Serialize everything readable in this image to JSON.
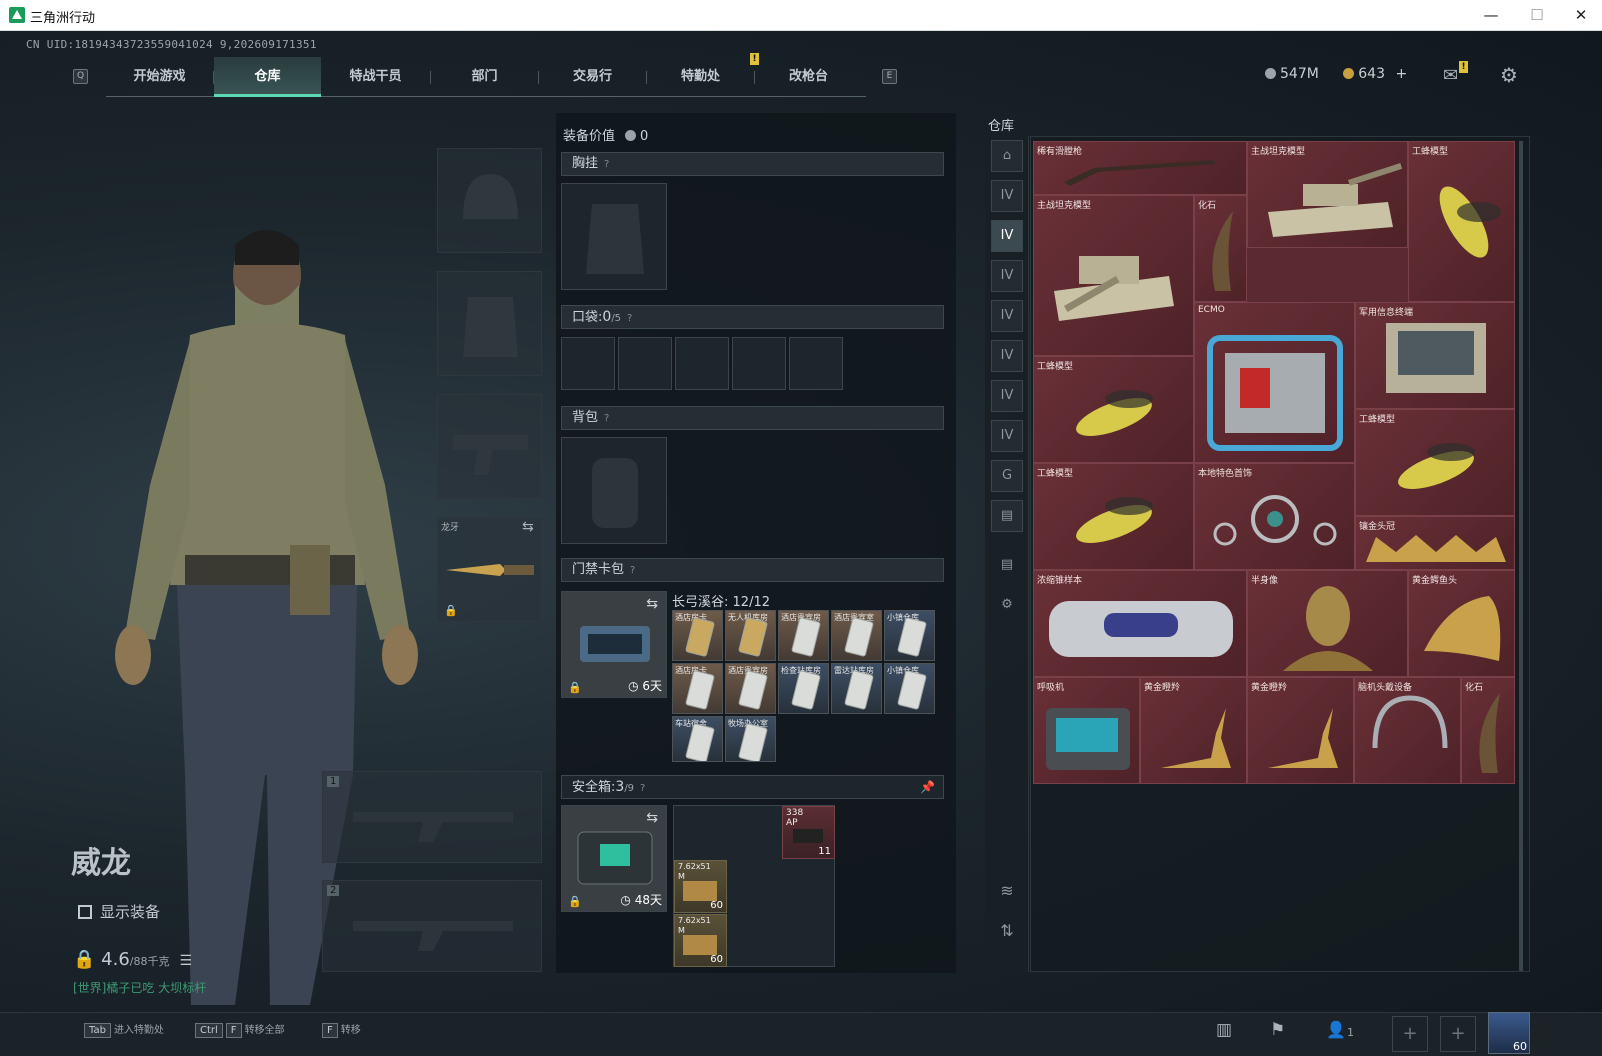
{
  "window": {
    "title": "三角洲行动",
    "minimize": "—",
    "maximize": "☐",
    "close": "✕"
  },
  "uid": "CN UID:18194343723559041024 9,202609171351",
  "nav": {
    "key_left": "Q",
    "key_right": "E",
    "tabs": [
      "开始游戏",
      "仓库",
      "特战干员",
      "部门",
      "交易行",
      "特勤处",
      "改枪台"
    ],
    "active": "仓库",
    "notice": "!"
  },
  "currency": {
    "silver": "547M",
    "gold": "643",
    "plus": "+",
    "mail_badge": "!"
  },
  "character": {
    "name": "威龙",
    "show_equipment": "显示装备",
    "weight": "4.6",
    "weight_max": "/88千克",
    "world_tag": "[世界]",
    "world_title": "橘子已吃 大坝标杆"
  },
  "gear_slots": {
    "melee_label": "龙牙",
    "primary_num": "1",
    "secondary_num": "2"
  },
  "equipment": {
    "value_label": "装备价值",
    "value": "0",
    "chest_rig": "胸挂",
    "pockets_label": "口袋:",
    "pockets_value": "0",
    "pockets_max": "/5",
    "backpack": "背包",
    "keycard_bag": "门禁卡包",
    "keycard_timer": "6天",
    "keycard_map": "长弓溪谷:",
    "keycard_count": "12/12",
    "keycards": [
      "酒店房卡",
      "无人机库房",
      "酒店贵宾房",
      "酒店贵宾室",
      "小镇仓库",
      "酒店房卡",
      "酒店贵宾房",
      "检查站库房",
      "雷达站库房",
      "小镇仓库",
      "车站宿舍",
      "牧场办公室"
    ],
    "safebox_label": "安全箱:",
    "safebox_value": "3",
    "safebox_max": "/9",
    "safebox_timer": "48天",
    "safebox_items": [
      {
        "label": "338",
        "sub": "AP",
        "count": "11"
      },
      {
        "label": "7.62x51",
        "sub": "M",
        "count": "60"
      },
      {
        "label": "7.62x51",
        "sub": "M",
        "count": "60"
      }
    ],
    "question": "?"
  },
  "warehouse": {
    "title": "仓库",
    "items": [
      "稀有滑膛枪",
      "主战坦克模型",
      "工蜂模型",
      "主战坦克模型",
      "化石",
      "ECMO",
      "军用信息终端",
      "工蜂模型",
      "工蜂模型",
      "工蜂模型",
      "本地特色首饰",
      "镶金头冠",
      "浓缩锥样本",
      "半身像",
      "黄金鳄鱼头",
      "呼吸机",
      "黄金瞪羚",
      "黄金瞪羚",
      "脑机头戴设备",
      "化石"
    ]
  },
  "bottom": {
    "hints": [
      {
        "key": "Tab",
        "text": "进入特勤处"
      },
      {
        "key": "Ctrl",
        "key2": "F",
        "text": "转移全部"
      },
      {
        "key": "F",
        "text": "转移"
      }
    ],
    "friends": "1",
    "level": "60"
  },
  "colors": {
    "accent": "#5fd6b2",
    "item_bg": "#5a2a30",
    "world": "#3e9a73"
  }
}
